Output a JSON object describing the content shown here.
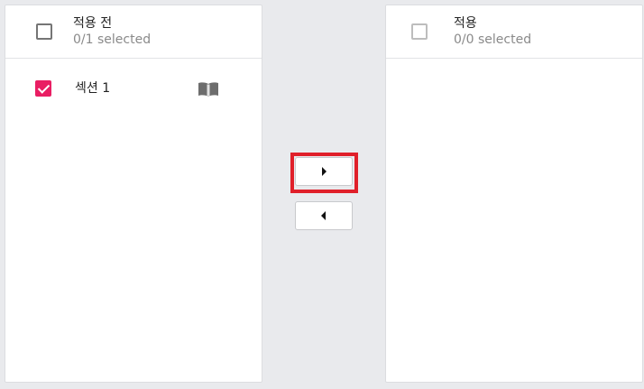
{
  "source_panel": {
    "title": "적용 전",
    "selected_count": "0/1 selected",
    "items": [
      {
        "label": "섹션 1",
        "checked": true,
        "icon": "book-icon"
      }
    ]
  },
  "target_panel": {
    "title": "적용",
    "selected_count": "0/0 selected",
    "items": []
  },
  "controls": {
    "move_right_icon": "arrow-right-icon",
    "move_left_icon": "arrow-left-icon"
  },
  "colors": {
    "accent": "#e91e63",
    "highlight": "#e0202a",
    "background": "#e9eaed"
  }
}
